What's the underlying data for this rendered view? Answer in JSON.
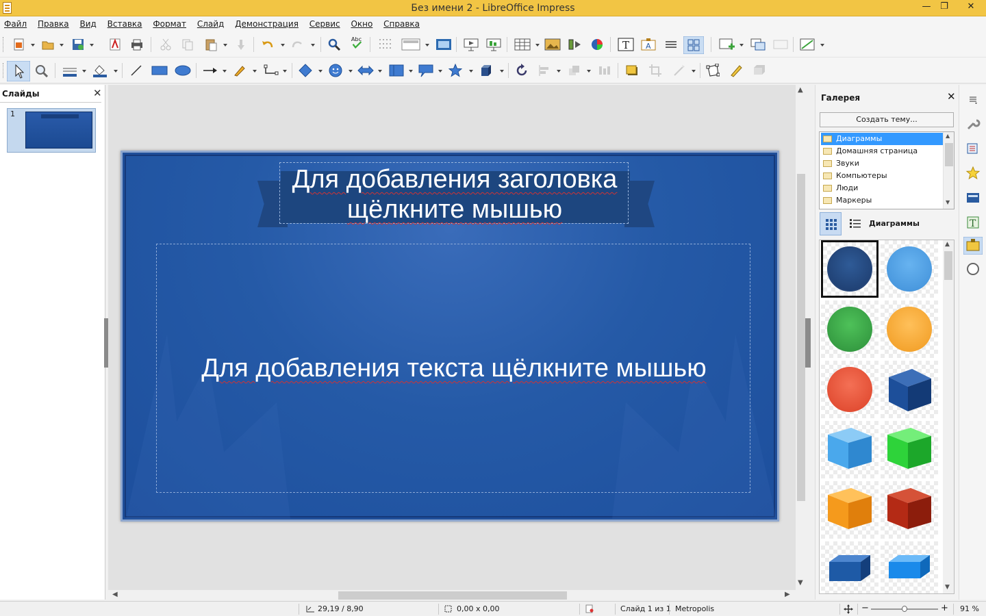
{
  "window": {
    "title": "Без имени 2 - LibreOffice Impress",
    "controls": {
      "minimize": "—",
      "restore": "❐",
      "close": "✕"
    }
  },
  "menu": [
    "Файл",
    "Правка",
    "Вид",
    "Вставка",
    "Формат",
    "Слайд",
    "Демонстрация",
    "Сервис",
    "Окно",
    "Справка"
  ],
  "slides_panel": {
    "title": "Слайды",
    "close": "✕",
    "slides": [
      {
        "number": "1"
      }
    ]
  },
  "slide": {
    "title_placeholder_line1": "Для добавления заголовка",
    "title_placeholder_line2": "щёлкните мышью",
    "body_placeholder": "Для добавления текста щёлкните мышью",
    "colors": {
      "background": "#1f4e99",
      "ribbon": "#1f4782"
    }
  },
  "gallery": {
    "title": "Галерея",
    "close": "✕",
    "new_theme_button": "Создать тему...",
    "themes": [
      "Диаграммы",
      "Домашняя страница",
      "Звуки",
      "Компьютеры",
      "Люди",
      "Маркеры"
    ],
    "selected_theme": "Диаграммы",
    "current_theme_label": "Диаграммы",
    "items": [
      {
        "name": "dark-blue-ball",
        "color": "#2f5b97"
      },
      {
        "name": "light-blue-ball",
        "color": "#4fa3e8"
      },
      {
        "name": "green-ball",
        "color": "#3daa48"
      },
      {
        "name": "orange-ball",
        "color": "#f6a93a"
      },
      {
        "name": "red-ball",
        "color": "#e8563f"
      },
      {
        "name": "dark-blue-cube",
        "color": "#1d4f9a"
      },
      {
        "name": "light-blue-cube",
        "color": "#4aa8ec"
      },
      {
        "name": "green-cube",
        "color": "#2ed33a"
      },
      {
        "name": "orange-cube",
        "color": "#f59a1c"
      },
      {
        "name": "dark-red-cube",
        "color": "#b42a15"
      },
      {
        "name": "blue-flat-box",
        "color": "#1e5aa6"
      },
      {
        "name": "bright-blue-flat-box",
        "color": "#1a8aea"
      }
    ]
  },
  "status": {
    "position": "29,19 / 8,90",
    "size": "0,00 x 0,00",
    "slide": "Слайд 1 из 1",
    "master": "Metropolis",
    "zoom": "91 %",
    "zoom_slider_value": 0.5
  }
}
